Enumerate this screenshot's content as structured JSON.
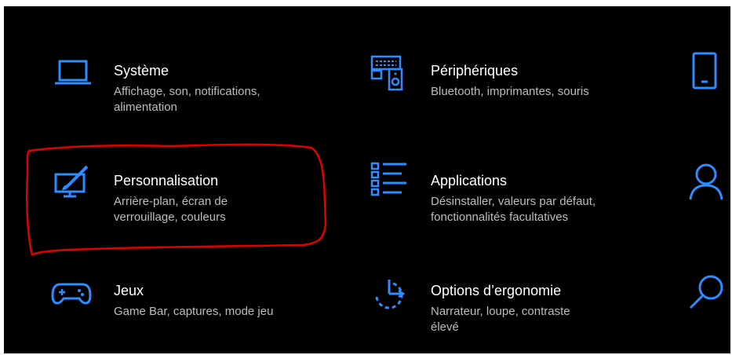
{
  "colors": {
    "background": "#000000",
    "accent": "#2f8cff",
    "title": "#ffffff",
    "description": "#bdbdbd",
    "annotation": "#e00000"
  },
  "tiles": [
    {
      "icon": "laptop-icon",
      "title": "Système",
      "desc_lines": [
        "Affichage, son, notifications,",
        "alimentation"
      ]
    },
    {
      "icon": "devices-icon",
      "title": "Périphériques",
      "desc_lines": [
        "Bluetooth, imprimantes, souris"
      ]
    },
    {
      "icon": "phone-icon"
    },
    {
      "icon": "personalization-icon",
      "title": "Personnalisation",
      "desc_lines": [
        "Arrière-plan, écran de",
        "verrouillage, couleurs"
      ]
    },
    {
      "icon": "apps-list-icon",
      "title": "Applications",
      "desc_lines": [
        "Désinstaller, valeurs par défaut,",
        "fonctionnalités facultatives"
      ]
    },
    {
      "icon": "person-icon"
    },
    {
      "icon": "gamepad-icon",
      "title": "Jeux",
      "desc_lines": [
        "Game Bar, captures, mode jeu"
      ]
    },
    {
      "icon": "ease-of-access-icon",
      "title": "Options d’ergonomie",
      "desc_lines": [
        "Narrateur, loupe, contraste",
        "élevé"
      ]
    },
    {
      "icon": "search-icon"
    }
  ]
}
